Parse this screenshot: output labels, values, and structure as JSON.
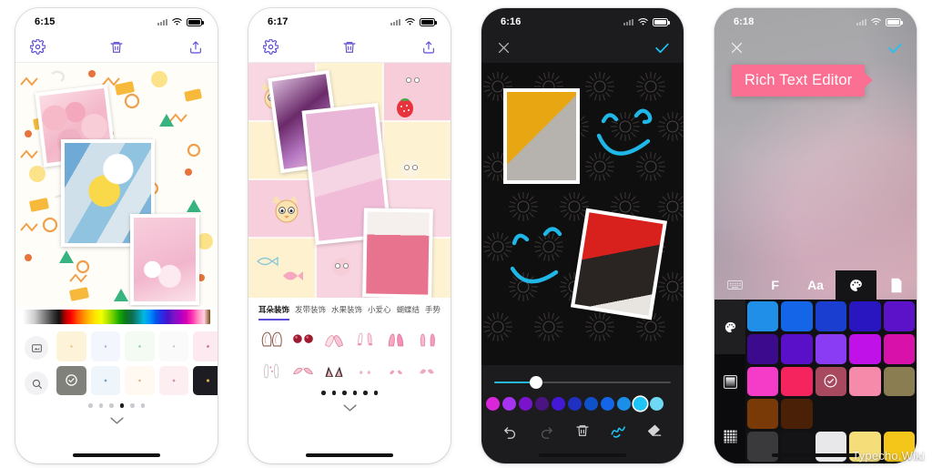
{
  "screens": [
    {
      "id": "collage-editor-memphis",
      "status": {
        "time": "6:15",
        "signal": "cellular-signal-icon",
        "wifi": "wifi-icon",
        "battery": "battery-full-icon"
      },
      "topbar": {
        "settings": "settings-gear-icon",
        "delete": "trash-icon",
        "share": "share-upload-icon"
      },
      "background_picker": {
        "spectrum_label": "color-spectrum-strip",
        "side_buttons": [
          "photo-icon",
          "search-icon"
        ],
        "selected_index": 6,
        "page_dots": 6,
        "active_dot": 3
      }
    },
    {
      "id": "sticker-editor-cats",
      "status": {
        "time": "6:17",
        "signal": "cellular-signal-icon",
        "wifi": "wifi-icon",
        "battery": "battery-full-icon"
      },
      "topbar": {
        "settings": "settings-gear-icon",
        "delete": "trash-icon",
        "share": "share-upload-icon"
      },
      "tabs": [
        {
          "label": "耳朵装饰",
          "active": true
        },
        {
          "label": "发带装饰",
          "active": false
        },
        {
          "label": "水果装饰",
          "active": false
        },
        {
          "label": "小爱心",
          "active": false
        },
        {
          "label": "蝴蝶结",
          "active": false
        },
        {
          "label": "手势",
          "active": false
        }
      ],
      "page_dots": 6,
      "active_dot": -1
    },
    {
      "id": "doodle-editor-dark",
      "status": {
        "time": "6:16",
        "signal": "cellular-signal-icon",
        "wifi": "wifi-icon",
        "battery": "battery-full-icon"
      },
      "topbar": {
        "close": "close-x-icon",
        "confirm": "checkmark-icon"
      },
      "brush": {
        "size_percent": 20
      },
      "palette": {
        "colors": [
          "#d926d9",
          "#a633f0",
          "#7a14cc",
          "#4a1580",
          "#4318d6",
          "#2030c0",
          "#1050c8",
          "#1565e8",
          "#1b8fe8",
          "#1fc3f5",
          "#6fd8f5"
        ],
        "selected_index": 9
      },
      "tools": [
        {
          "name": "undo",
          "label": "undo-icon",
          "enabled": true
        },
        {
          "name": "redo",
          "label": "redo-icon",
          "enabled": false
        },
        {
          "name": "delete",
          "label": "trash-icon",
          "enabled": true
        },
        {
          "name": "brush",
          "label": "brush-scribble-icon",
          "enabled": true,
          "active": true
        },
        {
          "name": "eraser",
          "label": "eraser-icon",
          "enabled": true
        }
      ]
    },
    {
      "id": "rich-text-editor",
      "status": {
        "time": "6:18",
        "signal": "cellular-signal-icon",
        "wifi": "wifi-icon",
        "battery": "battery-full-icon"
      },
      "topbar": {
        "close": "close-x-icon",
        "confirm": "checkmark-icon"
      },
      "text_banner": {
        "text": "Rich Text Editor",
        "background": "#fb6f92",
        "color": "#ffffff"
      },
      "format_tabs": [
        {
          "name": "keyboard",
          "label": "keyboard-icon",
          "active": false
        },
        {
          "name": "font",
          "label": "F",
          "active": false
        },
        {
          "name": "text-size",
          "label": "Aa",
          "active": false
        },
        {
          "name": "color",
          "label": "palette-icon",
          "active": true
        },
        {
          "name": "shape",
          "label": "page-shape-icon",
          "active": false
        }
      ],
      "palette_side": [
        {
          "name": "color",
          "label": "palette-icon",
          "active": true
        },
        {
          "name": "gradient",
          "label": "gradient-square-icon",
          "active": false
        },
        {
          "name": "texture",
          "label": "grid-texture-icon",
          "active": false
        }
      ],
      "palette_rows": [
        [
          "#1f8fe8",
          "#1565e8",
          "#1a3fd0",
          "#2a16c0",
          "#5b12c8"
        ],
        [
          "#3c0a8c",
          "#5a10c8",
          "#8a3cf5",
          "#bf11e8",
          "#d911ab"
        ],
        [
          "#f53cc8",
          "#f5245f",
          "#a8495f",
          "#f58aaa",
          "#8a7d52"
        ],
        [
          "#7a3a08",
          "#4a2106",
          null,
          null,
          null
        ],
        [
          "#3a3a3c",
          "#141416",
          "#e8e8ea",
          "#f5dd7a",
          "#f5c61a"
        ]
      ],
      "selected_cell": {
        "row": 2,
        "col": 2,
        "icon": "check-circle-icon"
      }
    }
  ],
  "watermark": "Typecho.Wiki"
}
